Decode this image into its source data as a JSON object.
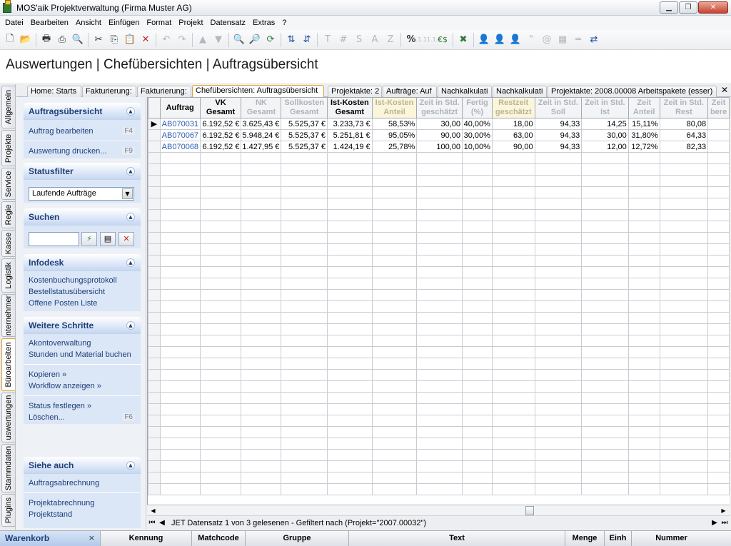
{
  "window": {
    "title": "MOS'aik Projektverwaltung (Firma Muster AG)"
  },
  "menu": [
    "Datei",
    "Bearbeiten",
    "Ansicht",
    "Einfügen",
    "Format",
    "Projekt",
    "Datensatz",
    "Extras",
    "?"
  ],
  "toolbar_text": {
    "t": "T",
    "hash": "#",
    "s": "S",
    "a": "A",
    "z": "Z",
    "percent": "%",
    "num1": "1.1.1",
    "num2": "1.1.2",
    "euro": "€$",
    "quote": "\"",
    "at": "@"
  },
  "page_title": "Auswertungen | Chefübersichten | Auftragsübersicht",
  "vertical_tabs": [
    "Allgemein",
    "Projekte",
    "Service",
    "Regie",
    "Kasse",
    "Logistik",
    "nternehmer",
    "Büroarbeiten",
    "uswertungen",
    "Stammdaten",
    "Plugins"
  ],
  "document_tabs": [
    "Home: Starts",
    "Fakturierung:",
    "Fakturierung:",
    "Chefübersichten: Auftragsübersicht",
    "Projektakte: 2",
    "Aufträge: Auf",
    "Nachkalkulati",
    "Nachkalkulati",
    "Projektakte: 2008.00008 Arbeitspakete (esser)"
  ],
  "taskpane": {
    "auftrag": {
      "title": "Auftragsübersicht",
      "items": [
        {
          "label": "Auftrag bearbeiten",
          "key": "F4"
        },
        {
          "label": "Auswertung drucken...",
          "key": "F9"
        }
      ]
    },
    "status": {
      "title": "Statusfilter",
      "selected": "Laufende Aufträge"
    },
    "suchen": {
      "title": "Suchen",
      "value": ""
    },
    "infodesk": {
      "title": "Infodesk",
      "items": [
        "Kostenbuchungsprotokoll",
        "Bestellstatusübersicht",
        "Offene Posten Liste"
      ]
    },
    "weitere": {
      "title": "Weitere Schritte",
      "items": [
        {
          "label": "Akontoverwaltung"
        },
        {
          "label": "Stunden und Material buchen"
        },
        {
          "label": "Kopieren »"
        },
        {
          "label": "Workflow anzeigen »"
        },
        {
          "label": "Status festlegen »"
        },
        {
          "label": "Löschen...",
          "key": "F6"
        }
      ]
    },
    "siehe": {
      "title": "Siehe auch",
      "items": [
        "Auftragsabrechnung",
        "Projektabrechnung",
        "Projektstand"
      ]
    }
  },
  "grid": {
    "columns": [
      {
        "l1": "Auftrag",
        "l2": "",
        "style": "normal"
      },
      {
        "l1": "VK",
        "l2": "Gesamt",
        "style": "normal"
      },
      {
        "l1": "NK",
        "l2": "Gesamt",
        "style": "gray"
      },
      {
        "l1": "Sollkosten",
        "l2": "Gesamt",
        "style": "gray"
      },
      {
        "l1": "Ist-Kosten",
        "l2": "Gesamt",
        "style": "normal"
      },
      {
        "l1": "Ist-Kosten",
        "l2": "Anteil",
        "style": "hl"
      },
      {
        "l1": "Zeit in Std.",
        "l2": "geschätzt",
        "style": "gray"
      },
      {
        "l1": "Fertig",
        "l2": "(%)",
        "style": "gray"
      },
      {
        "l1": "Restzeit",
        "l2": "geschätzt",
        "style": "hl"
      },
      {
        "l1": "Zeit in Std.",
        "l2": "Soll",
        "style": "gray"
      },
      {
        "l1": "Zeit in Std.",
        "l2": "Ist",
        "style": "gray"
      },
      {
        "l1": "Zeit",
        "l2": "Anteil",
        "style": "gray"
      },
      {
        "l1": "Zeit in Std.",
        "l2": "Rest",
        "style": "gray"
      },
      {
        "l1": "Zeit",
        "l2": "bere",
        "style": "gray"
      }
    ],
    "rows": [
      [
        "AB070031",
        "6.192,52 €",
        "3.625,43 €",
        "5.525,37 €",
        "3.233,73 €",
        "58,53%",
        "30,00",
        "40,00%",
        "18,00",
        "94,33",
        "14,25",
        "15,11%",
        "80,08",
        ""
      ],
      [
        "AB070067",
        "6.192,52 €",
        "5.948,24 €",
        "5.525,37 €",
        "5.251,81 €",
        "95,05%",
        "90,00",
        "30,00%",
        "63,00",
        "94,33",
        "30,00",
        "31,80%",
        "64,33",
        ""
      ],
      [
        "AB070068",
        "6.192,52 €",
        "1.427,95 €",
        "5.525,37 €",
        "1.424,19 €",
        "25,78%",
        "100,00",
        "10,00%",
        "90,00",
        "94,33",
        "12,00",
        "12,72%",
        "82,33",
        ""
      ]
    ]
  },
  "status_text": "JET Datensatz 1 von 3 gelesenen - Gefiltert nach (Projekt=\"2007.00032\")",
  "basket": {
    "title": "Warenkorb",
    "close": "×",
    "columns": [
      "Kennung",
      "Matchcode",
      "Gruppe",
      "Text",
      "Menge",
      "Einh",
      "Nummer"
    ]
  }
}
